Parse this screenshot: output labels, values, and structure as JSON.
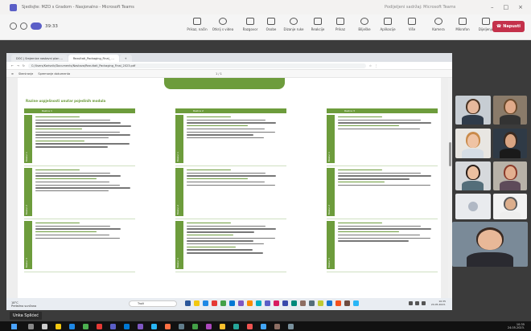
{
  "teams": {
    "window_title": "Sjedisjte: MZO s Gradom - Nasjonalno - Microsoft Teams",
    "center_title": "Podijeljeni sadržaj: Microsoft Teams",
    "timer": "39:33",
    "toolbar": [
      {
        "label": "Prikaz, način",
        "icon": "layout-icon"
      },
      {
        "label": "Otkrij s videa",
        "icon": "video-icon"
      },
      {
        "label": "Razgovor",
        "icon": "chat-icon"
      },
      {
        "label": "Osobe",
        "icon": "people-icon"
      },
      {
        "label": "Dizanje ruke",
        "icon": "raise-hand-icon"
      },
      {
        "label": "Reakcije",
        "icon": "reaction-icon"
      },
      {
        "label": "Prikaz",
        "icon": "view-icon"
      },
      {
        "label": "Bilješke",
        "icon": "notes-icon"
      },
      {
        "label": "Aplikacije",
        "icon": "apps-icon"
      },
      {
        "label": "Više",
        "icon": "more-icon"
      },
      {
        "label": "Kamera",
        "icon": "camera-icon"
      },
      {
        "label": "Mikrofon",
        "icon": "mic-icon"
      },
      {
        "label": "Dijeljenje",
        "icon": "share-icon"
      }
    ],
    "leave_label": "Napusti"
  },
  "browser": {
    "tabs": [
      "DOC | Smjernice nastavni plan ...",
      "Rezultati_Packaging_Final_ ..."
    ],
    "address": "C:/Users/Korisnik/Documents/Nastava/Rezultati_Packaging_Final_2023.pdf",
    "pdf_toolbar": {
      "zoom": "Skeniranje",
      "page": "1",
      "of": "/ 1",
      "search": "Spremanje dokumenta"
    }
  },
  "document": {
    "title": "Razine uspješnosti unutar pojedinih modula",
    "columns": [
      {
        "header": "Razina 1"
      },
      {
        "header": "Razina 2"
      },
      {
        "header": "Razina 3"
      }
    ],
    "rows": [
      {
        "side": "Modul 1"
      },
      {
        "side": "Modul 2"
      },
      {
        "side": "Modul 3"
      }
    ]
  },
  "inner_taskbar": {
    "weather_temp": "18°C",
    "weather_desc": "Pretežno sunčano",
    "search_placeholder": "Traži",
    "clock_time": "10:35",
    "clock_date": "24.05.2023."
  },
  "participant_name": "Unka Splićeć",
  "host_taskbar": {
    "time": "10:35",
    "date": "24.05.2023."
  }
}
